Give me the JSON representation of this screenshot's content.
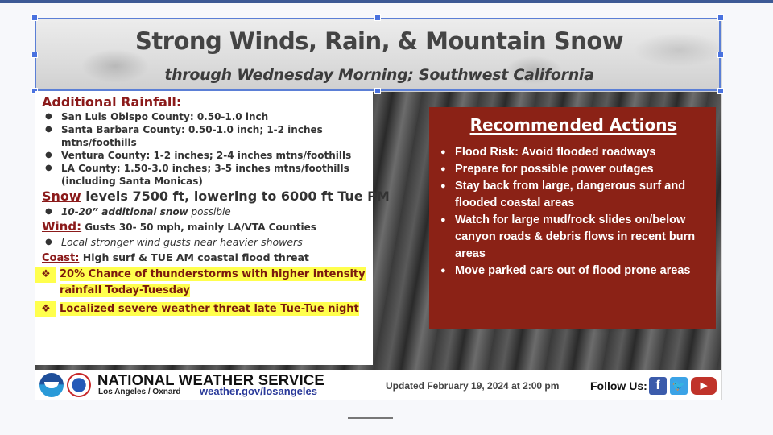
{
  "title": {
    "main": "Strong Winds, Rain, & Mountain Snow",
    "sub": "through Wednesday Morning; Southwest California"
  },
  "rainfall": {
    "heading": "Additional Rainfall:",
    "items": [
      "San Luis Obispo County: 0.50-1.0 inch",
      "Santa Barbara County: 0.50-1.0 inch; 1-2 inches mtns/foothills",
      "Ventura County: 1-2 inches; 2-4 inches mtns/foothills",
      "LA County: 1.50-3.0 inches; 3-5 inches mtns/foothills (including Santa Monicas)"
    ]
  },
  "snow": {
    "label": "Snow",
    "text": " levels 7500 ft, lowering to 6000 ft Tue PM",
    "bullet_bold": "10-20” additional snow",
    "bullet_rest": " possible"
  },
  "wind": {
    "label": "Wind:",
    "text": " Gusts 30- 50 mph, mainly LA/VTA Counties",
    "bullet": "Local stronger wind gusts near heavier showers"
  },
  "coast": {
    "label": "Coast:",
    "text": " High surf & TUE AM coastal flood threat"
  },
  "highlights": [
    "20% Chance of thunderstorms with higher intensity rainfall Today-Tuesday",
    "Localized severe weather threat late Tue-Tue night"
  ],
  "highlight_symbol": "❖",
  "actions": {
    "heading": "Recommended Actions",
    "items": [
      "Flood Risk: Avoid flooded roadways",
      "Prepare for possible power outages",
      "Stay back from large, dangerous surf and flooded coastal areas",
      "Watch for large mud/rock slides on/below canyon roads & debris flows in recent burn areas",
      "Move parked cars out of flood prone areas"
    ]
  },
  "footer": {
    "agency": "NATIONAL WEATHER SERVICE",
    "office": "Los Angeles / Oxnard",
    "url": "weather.gov/losangeles",
    "updated": "Updated February 19, 2024 at 2:00 pm",
    "follow": "Follow Us:",
    "social": {
      "facebook": "f",
      "twitter": "🐦",
      "youtube": "▶"
    }
  },
  "colors": {
    "heading_red": "#8b1a1a",
    "actions_bg": "#8b2216",
    "highlight": "#ffff4d",
    "selection": "#4a72df"
  }
}
